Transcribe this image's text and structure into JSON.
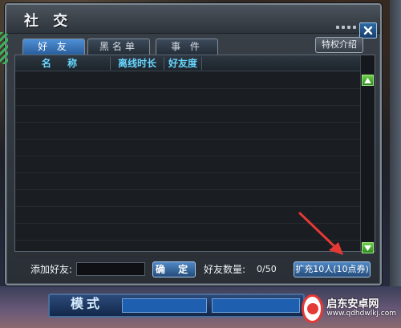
{
  "window": {
    "title": "社 交"
  },
  "tabs": [
    {
      "label": "好 友",
      "active": true
    },
    {
      "label": "黑名单",
      "active": false
    },
    {
      "label": "事 件",
      "active": false
    }
  ],
  "privilege_button": "特权介绍",
  "friend_list": {
    "columns": [
      "名  称",
      "离线时长",
      "好友度"
    ],
    "rows": []
  },
  "footer": {
    "add_friend_label": "添加好友:",
    "add_friend_value": "",
    "confirm_label": "确 定",
    "friend_count_label": "好友数量:",
    "friend_count_value": "0/50",
    "expand_button": "扩充10人(10点券)"
  },
  "background": {
    "mode_label": "模式"
  },
  "watermark": {
    "name": "启东安卓网",
    "url": "www.qdhdwlkj.com"
  },
  "colors": {
    "tab_active": "#2a5e9c",
    "column_header_text": "#66d6ff",
    "scroll_button": "#2f8a1f",
    "annotation_arrow": "#e53935"
  },
  "icons": {
    "close": "close-icon",
    "scroll_up": "triangle-up-icon",
    "scroll_down": "triangle-down-icon",
    "arrow": "red-arrow-annotation"
  }
}
